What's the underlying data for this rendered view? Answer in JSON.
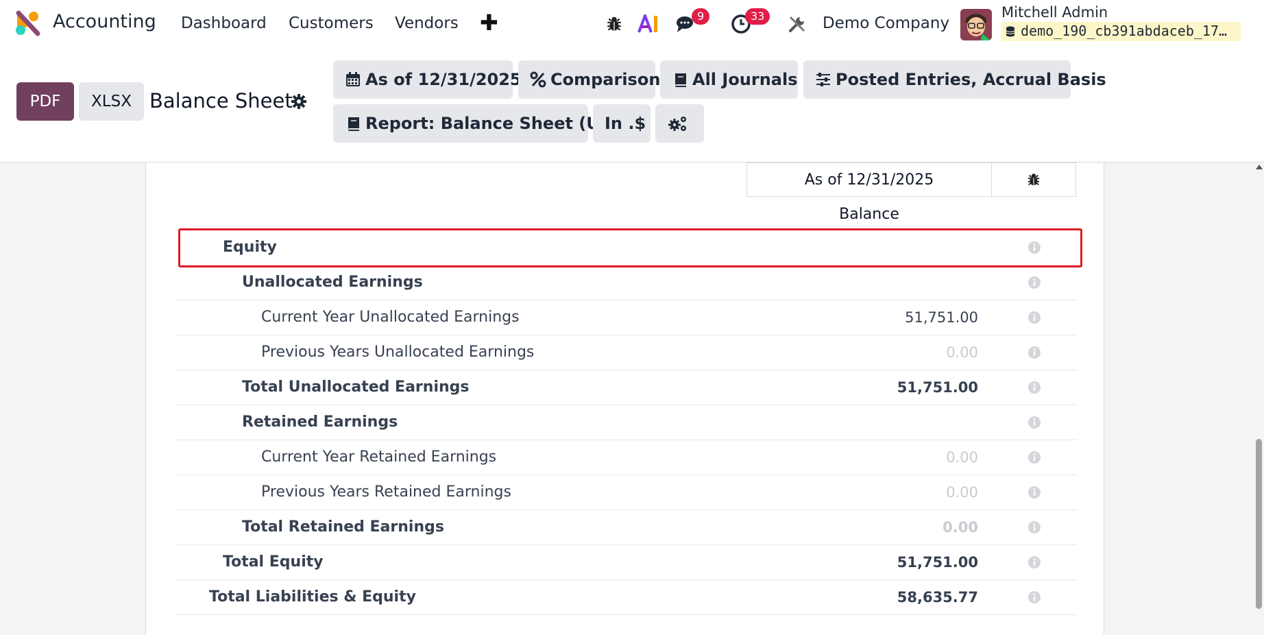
{
  "navbar": {
    "app_name": "Accounting",
    "menu": [
      "Dashboard",
      "Customers",
      "Vendors"
    ],
    "messages_badge": "9",
    "activities_badge": "33",
    "company": "Demo Company",
    "user_name": "Mitchell Admin",
    "database": "demo_190_cb391abdaceb_17…"
  },
  "controls": {
    "pdf_label": "PDF",
    "xlsx_label": "XLSX",
    "report_title": "Balance Sheet",
    "filters": {
      "date": "As of 12/31/2025",
      "comparison": "Comparison",
      "journals": "All Journals",
      "options": "Posted Entries, Accrual Basis",
      "report": "Report: Balance Sheet (US)",
      "currency": "In .$"
    }
  },
  "table": {
    "column_header": "As of 12/31/2025",
    "balance_label": "Balance",
    "rows": [
      {
        "label": "Equity",
        "amount": "",
        "level": 1,
        "bold": true
      },
      {
        "label": "Unallocated Earnings",
        "amount": "",
        "level": 2,
        "bold": true
      },
      {
        "label": "Current Year Unallocated Earnings",
        "amount": "51,751.00",
        "level": 3,
        "bold": false
      },
      {
        "label": "Previous Years Unallocated Earnings",
        "amount": "0.00",
        "level": 3,
        "bold": false
      },
      {
        "label": "Total Unallocated Earnings",
        "amount": "51,751.00",
        "level": 2,
        "bold": true
      },
      {
        "label": "Retained Earnings",
        "amount": "",
        "level": 2,
        "bold": true
      },
      {
        "label": "Current Year Retained Earnings",
        "amount": "0.00",
        "level": 3,
        "bold": false
      },
      {
        "label": "Previous Years Retained Earnings",
        "amount": "0.00",
        "level": 3,
        "bold": false
      },
      {
        "label": "Total Retained Earnings",
        "amount": "0.00",
        "level": 2,
        "bold": true
      },
      {
        "label": "Total Equity",
        "amount": "51,751.00",
        "level": 1,
        "bold": true
      },
      {
        "label": "Total Liabilities & Equity",
        "amount": "58,635.77",
        "level": 0,
        "bold": true
      }
    ]
  },
  "colors": {
    "primary": "#71405f",
    "badge": "#e11d48",
    "highlight": "#e01b24",
    "db_chip": "#fdf6c8"
  }
}
